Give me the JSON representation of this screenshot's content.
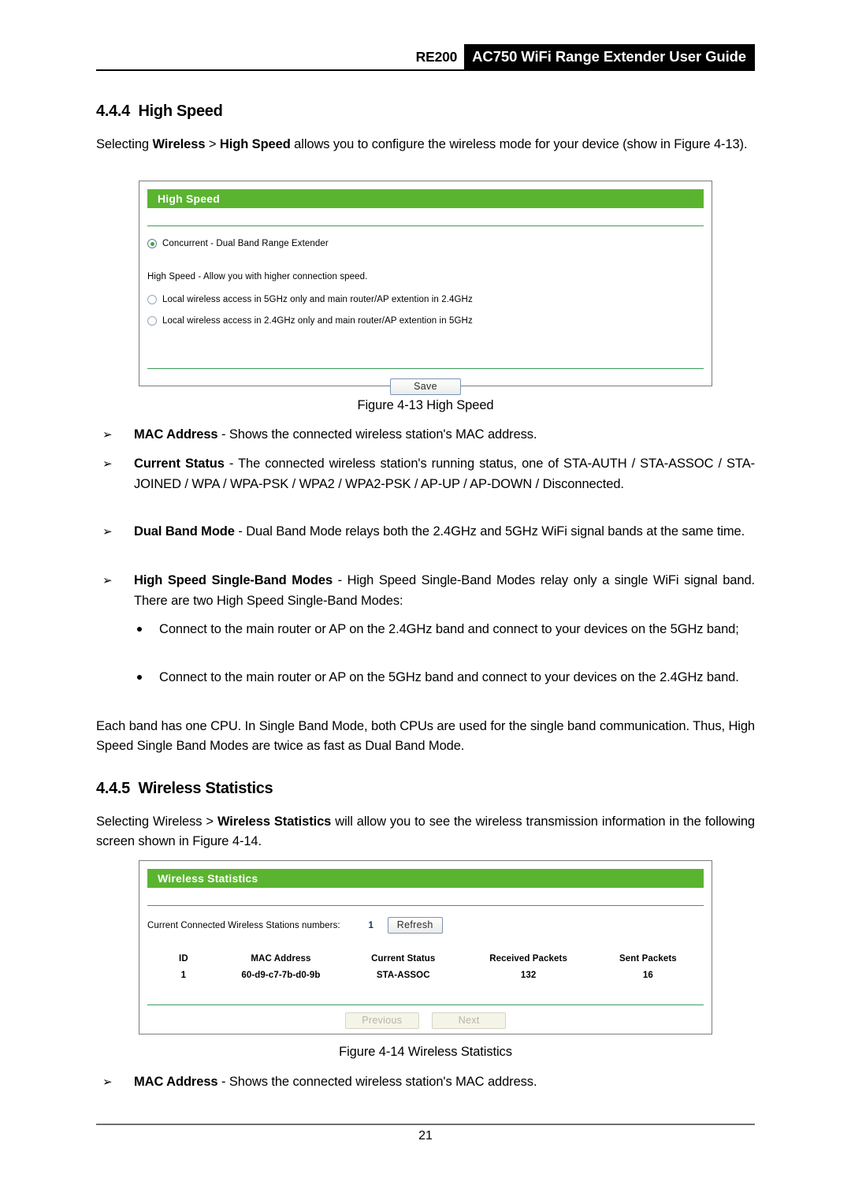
{
  "header": {
    "model": "RE200",
    "title": "AC750 WiFi Range Extender User Guide"
  },
  "sections": {
    "high_speed": {
      "number": "4.4.4",
      "heading": "High Speed",
      "intro_a": "Selecting ",
      "intro_b": "Wireless",
      "intro_c": " > ",
      "intro_d": "High Speed",
      "intro_e": " allows you to configure the wireless mode for your device (show in Figure 4-13).",
      "figure_caption": "Figure 4-13 High Speed"
    },
    "wireless_statistics": {
      "number": "4.4.5",
      "heading": "Wireless Statistics",
      "intro_a": "Selecting Wireless > ",
      "intro_b": "Wireless Statistics",
      "intro_c": " will allow you to see the wireless transmission information in the following screen shown in Figure 4-14.",
      "figure_caption": "Figure 4-14 Wireless Statistics"
    }
  },
  "high_speed_panel": {
    "title": "High Speed",
    "options": [
      {
        "label": "Concurrent - Dual Band Range Extender",
        "selected": true
      },
      {
        "label": "Local wireless access in 5GHz only and main router/AP extention in 2.4GHz",
        "selected": false
      },
      {
        "label": "Local wireless access in 2.4GHz only and main router/AP extention in 5GHz",
        "selected": false
      }
    ],
    "note": "High Speed - Allow you with higher connection speed.",
    "save_label": "Save"
  },
  "stats_panel": {
    "title": "Wireless Statistics",
    "count_label": "Current Connected Wireless Stations numbers:",
    "count_value": "1",
    "refresh_label": "Refresh",
    "columns": [
      "ID",
      "MAC Address",
      "Current Status",
      "Received Packets",
      "Sent Packets"
    ],
    "rows": [
      [
        "1",
        "60-d9-c7-7b-d0-9b",
        "STA-ASSOC",
        "132",
        "16"
      ]
    ],
    "previous_label": "Previous",
    "next_label": "Next"
  },
  "bullets": [
    {
      "marker": "➢",
      "term": "MAC Address",
      "sep": " - ",
      "text": "Shows the connected wireless station's MAC address."
    },
    {
      "marker": "➢",
      "term": "Current Status",
      "sep": " - ",
      "text": "The connected wireless station's running status, one of STA-AUTH / STA-ASSOC / STA-JOINED / WPA / WPA-PSK / WPA2 / WPA2-PSK / AP-UP / AP-DOWN / Disconnected."
    },
    {
      "marker": "➢",
      "term": "Dual Band Mode",
      "sep": " - ",
      "text": "Dual Band Mode relays both the 2.4GHz and 5GHz WiFi signal bands at the same time."
    },
    {
      "marker": "➢",
      "term": "High Speed Single-Band Modes",
      "sep": " - ",
      "text": "High Speed Single-Band Modes relay only a single WiFi signal band. There are two High Speed Single-Band Modes:"
    }
  ],
  "sub_bullets": [
    "Connect to the main router or AP on the 2.4GHz band and connect to your devices on the 5GHz band;",
    "Connect to the main router or AP on the 5GHz band and connect to your devices on the 2.4GHz band."
  ],
  "closing_paragraph": "Each band has one CPU. In Single Band Mode, both CPUs are used for the single band communication. Thus, High Speed Single Band Modes are twice as fast as Dual Band Mode.",
  "final_bullet": {
    "marker": "➢",
    "term": "MAC Address",
    "sep": " - ",
    "text": "Shows the connected wireless station's MAC address."
  },
  "footer": {
    "page_number": "21"
  },
  "colors": {
    "brand_green": "#5bb430",
    "rule_green": "#3d9b5a",
    "count_navy": "#1b2c6b"
  }
}
